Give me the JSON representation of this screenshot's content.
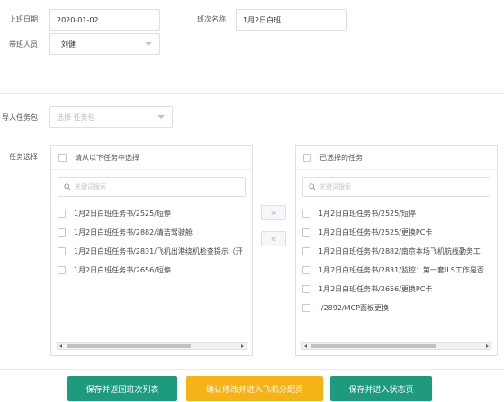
{
  "header": {
    "work_date_label": "上班日期",
    "work_date_value": "2020-01-02",
    "shift_name_label": "班次名称",
    "shift_name_value": "1月2日白班",
    "leader_label": "带班人员",
    "leader_value": "刘健"
  },
  "import": {
    "label": "导入任务包",
    "placeholder": "选择 任务包"
  },
  "task_select": {
    "label": "任务选择",
    "left": {
      "title": "请从以下任务中选择",
      "search_placeholder": "关键词搜索",
      "items": [
        "1月2日白班任务书/2525/短停",
        "1月2日白班任务书/2882/清洁驾驶舱",
        "1月2日白班任务书/2831/飞机出港绕机检查提示（开",
        "1月2日白班任务书/2656/短停"
      ]
    },
    "right": {
      "title": "已选择的任务",
      "search_placeholder": "关键词搜索",
      "items": [
        "1月2日白班任务书/2525/短停",
        "1月2日白班任务书/2525/更换PC卡",
        "1月2日白班任务书/2882/南京本场飞机航线勤务工",
        "1月2日白班任务书/2831/监控：第一套ILS工作是否",
        "1月2日白班任务书/2656/更换PC卡",
        "-/2892/MCP面板更换"
      ]
    },
    "to_right_label": "»",
    "to_left_label": "«"
  },
  "actions": {
    "save_return": "保存并返回班次列表",
    "confirm_flight": "确认修改并进入飞机分配页",
    "save_status": "保存并进入状态页"
  },
  "colors": {
    "primary_green": "#1e9b7e",
    "warning_yellow": "#f5b318"
  }
}
